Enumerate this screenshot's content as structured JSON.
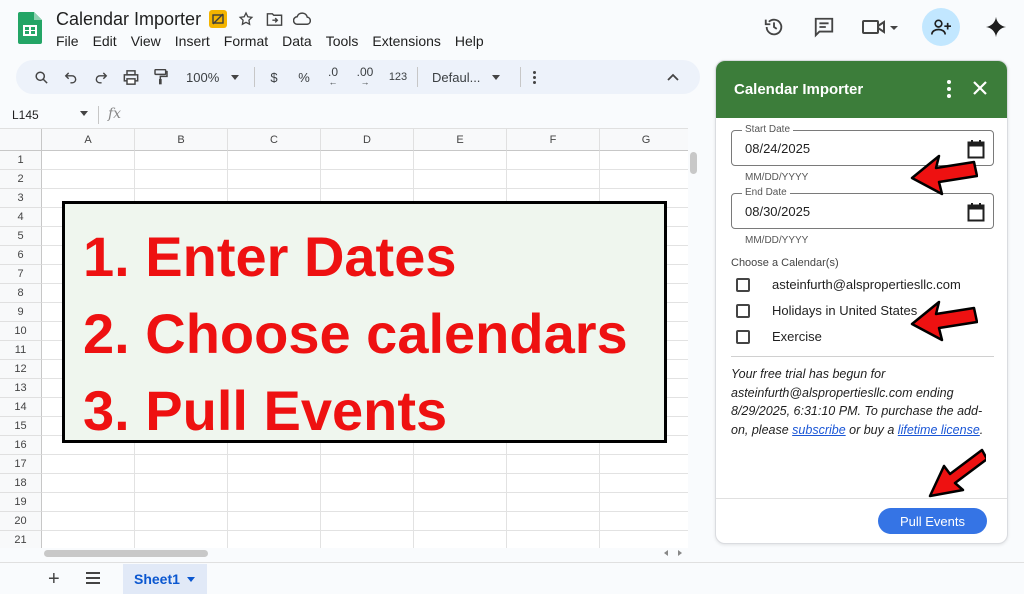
{
  "app": {
    "title": "Calendar Importer",
    "menu": [
      "File",
      "Edit",
      "View",
      "Insert",
      "Format",
      "Data",
      "Tools",
      "Extensions",
      "Help"
    ]
  },
  "toolbar": {
    "zoom": "100%",
    "currency": "$",
    "percent": "%",
    "dec_decrease": ".0",
    "dec_increase": ".00",
    "number_format": "123",
    "font": "Defaul..."
  },
  "formula_bar": {
    "name_box": "L145",
    "fx": "fx"
  },
  "grid": {
    "columns": [
      "A",
      "B",
      "C",
      "D",
      "E",
      "F",
      "G"
    ],
    "rows": [
      "1",
      "2",
      "3",
      "4",
      "5",
      "6",
      "7",
      "8",
      "9",
      "10",
      "11",
      "12",
      "13",
      "14",
      "15",
      "16",
      "17",
      "18",
      "19",
      "20",
      "21"
    ]
  },
  "overlay": {
    "lines": [
      "1. Enter Dates",
      "2. Choose calendars",
      "3. Pull Events"
    ],
    "color": "#ee1111",
    "background": "#eff6ee"
  },
  "sheets": {
    "active_tab": "Sheet1"
  },
  "sidebar": {
    "title": "Calendar Importer",
    "header_color": "#3c7d3a",
    "start_date": {
      "label": "Start Date",
      "value": "08/24/2025",
      "hint": "MM/DD/YYYY"
    },
    "end_date": {
      "label": "End Date",
      "value": "08/30/2025",
      "hint": "MM/DD/YYYY"
    },
    "choose_label": "Choose a Calendar(s)",
    "calendars": [
      "asteinfurth@alspropertiesllc.com",
      "Holidays in United States",
      "Exercise"
    ],
    "trial": {
      "text_before": "Your free trial has begun for asteinfurth@alspropertiesllc.com ending 8/29/2025, 6:31:10 PM. To purchase the add-on, please ",
      "link_subscribe": "subscribe",
      "text_middle": " or buy a ",
      "link_license": "lifetime license",
      "text_after": "."
    },
    "pull_button": "Pull Events",
    "button_color": "#3574e5"
  },
  "icons": {
    "header_right": [
      "history-icon",
      "comment-icon",
      "video-call-icon",
      "share-icon",
      "gemini-icon"
    ],
    "title": [
      "cloud-offline-icon",
      "star-icon",
      "move-folder-icon",
      "cloud-status-icon"
    ]
  }
}
